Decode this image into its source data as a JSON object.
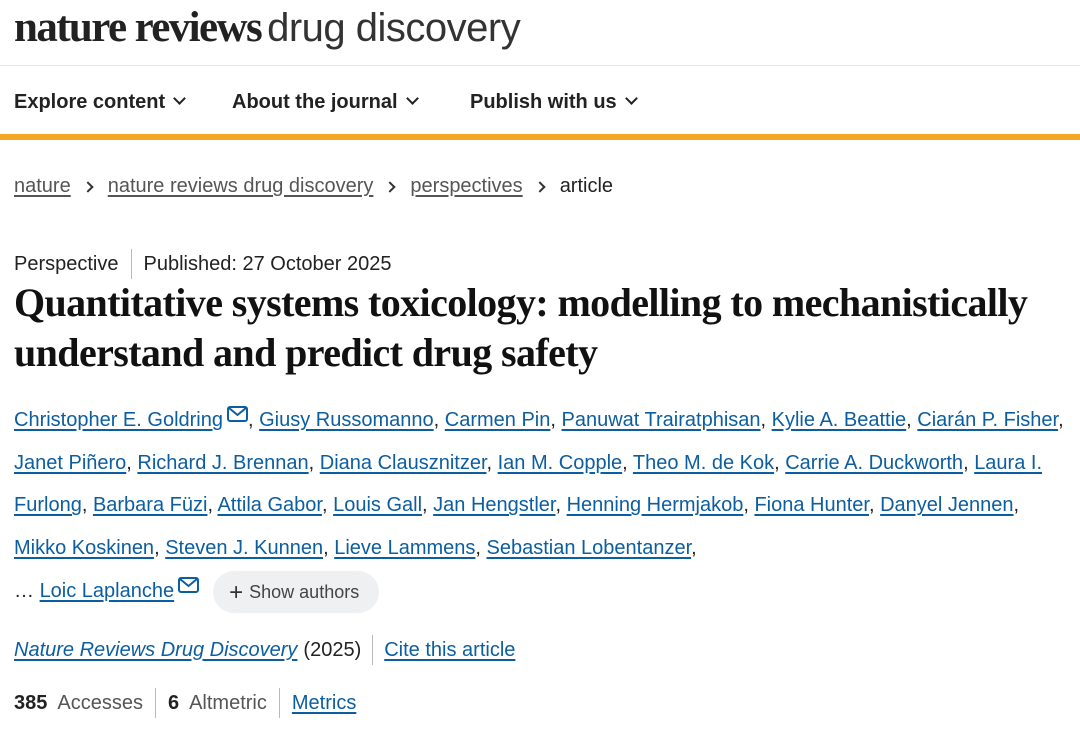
{
  "brand": {
    "logo_strong": "nature reviews",
    "logo_light": "drug discovery"
  },
  "nav": {
    "items": [
      {
        "label": "Explore content"
      },
      {
        "label": "About the journal"
      },
      {
        "label": "Publish with us"
      }
    ],
    "accent_color": "#f5a623"
  },
  "breadcrumb": {
    "items": [
      "nature",
      "nature reviews drug discovery",
      "perspectives"
    ],
    "current": "article"
  },
  "article": {
    "type": "Perspective",
    "published": "Published: 27 October 2025",
    "title": "Quantitative systems toxicology: modelling to mechanistically understand and predict drug safety",
    "authors": [
      "Christopher E. Goldring",
      "Giusy Russomanno",
      "Carmen Pin",
      "Panuwat Trairatphisan",
      "Kylie A. Beattie",
      "Ciarán P. Fisher",
      "Janet Piñero",
      "Richard J. Brennan",
      "Diana Clausznitzer",
      "Ian M. Copple",
      "Theo M. de Kok",
      "Carrie A. Duckworth",
      "Laura I. Furlong",
      "Barbara Füzi",
      "Attila Gabor",
      "Louis Gall",
      "Jan Hengstler",
      "Henning Hermjakob",
      "Fiona Hunter",
      "Danyel Jennen",
      "Mikko Koskinen",
      "Steven J. Kunnen",
      "Lieve Lammens",
      "Sebastian Lobentanzer"
    ],
    "ellipsis": "…",
    "last_author": "Loic Laplanche",
    "show_authors_label": "Show authors",
    "journal_name": "Nature Reviews Drug Discovery",
    "year": "(2025)",
    "cite_label": "Cite this article",
    "accesses_count": "385",
    "accesses_label": "Accesses",
    "altmetric_count": "6",
    "altmetric_label": "Altmetric",
    "metrics_label": "Metrics",
    "link_color": "#0c5ea1"
  }
}
